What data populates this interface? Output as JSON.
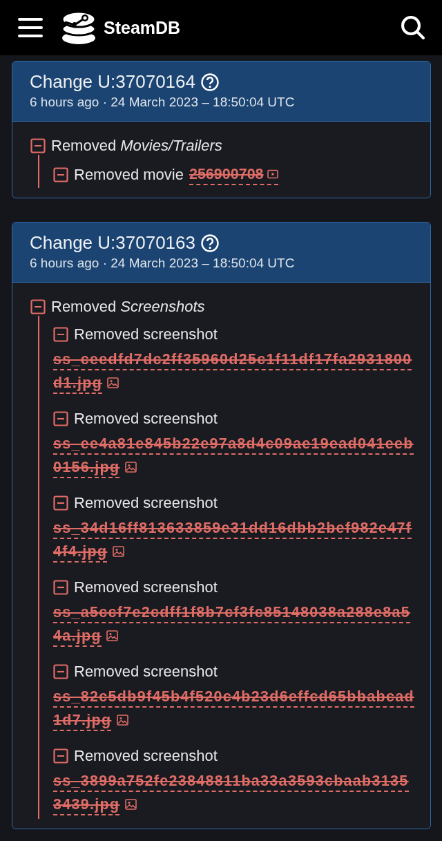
{
  "header": {
    "brand": "SteamDB"
  },
  "changes": [
    {
      "title": "Change U:37070164",
      "time": "6 hours ago · 24 March 2023 – 18:50:04 UTC",
      "groups": [
        {
          "action": "Removed",
          "section": "Movies/Trailers",
          "expanded": true,
          "items": [
            {
              "kind": "movie",
              "label": "Removed movie",
              "value": "256900708",
              "expanded": true
            }
          ]
        }
      ]
    },
    {
      "title": "Change U:37070163",
      "time": "6 hours ago · 24 March 2023 – 18:50:04 UTC",
      "groups": [
        {
          "action": "Removed",
          "section": "Screenshots",
          "expanded": true,
          "items": [
            {
              "kind": "screenshot",
              "label": "Removed screenshot",
              "value": "ss_ceedfd7dc2ff35960d25c1f11df17fa2931800d1.jpg",
              "expanded": true
            },
            {
              "kind": "screenshot",
              "label": "Removed screenshot",
              "value": "ss_ee4a81e845b22e97a8d4c09ae19ead041eeb0156.jpg",
              "expanded": true
            },
            {
              "kind": "screenshot",
              "label": "Removed screenshot",
              "value": "ss_34d16ff813633859e31dd16dbb2bef982e47f4f4.jpg",
              "expanded": true
            },
            {
              "kind": "screenshot",
              "label": "Removed screenshot",
              "value": "ss_a5ccf7e2cdff1f8b7cf3fc85148038a288e8a54a.jpg",
              "expanded": true
            },
            {
              "kind": "screenshot",
              "label": "Removed screenshot",
              "value": "ss_82c5db9f45b4f520c4b23d6effcd65bbabcad1d7.jpg",
              "expanded": true
            },
            {
              "kind": "screenshot",
              "label": "Removed screenshot",
              "value": "ss_3899a752fe23848811ba33a3593cbaab31353439.jpg",
              "expanded": true
            }
          ]
        }
      ]
    }
  ]
}
